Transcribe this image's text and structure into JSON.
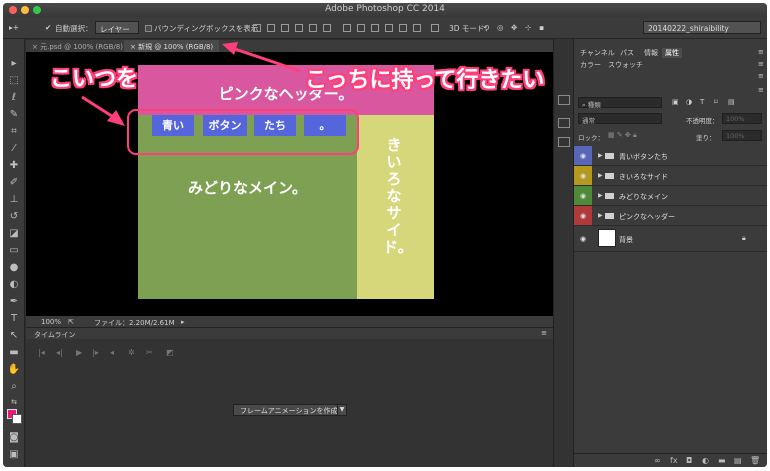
{
  "window": {
    "title": "Adobe Photoshop CC 2014"
  },
  "options_bar": {
    "auto_select_label": "自動選択：",
    "auto_select_value": "レイヤー",
    "bounding_box_label": "バウンディングボックスを表示",
    "mode_3d_label": "3D モード：",
    "workspace": "20140222_shiraibility"
  },
  "tabs": [
    {
      "label": "元.psd @ 100% (RGB/8)"
    },
    {
      "label": "新規 @ 100% (RGB/8)"
    }
  ],
  "document": {
    "header_text": "ピンクなヘッダー。",
    "main_text": "みどりなメイン。",
    "side_text": "きいろなサイド。",
    "buttons": [
      "青い",
      "ボタン",
      "たち",
      "。"
    ],
    "colors": {
      "header": "#d9579e",
      "main": "#7da053",
      "side": "#d6d67a",
      "buttons": "#5566dd",
      "annotation": "#ff3f7a"
    }
  },
  "annotations": {
    "left": "こいつを",
    "right": "こっちに持って行きたい"
  },
  "status": {
    "zoom": "100%",
    "file_info": "ファイル：2.20M/2.61M"
  },
  "timeline": {
    "title": "タイムライン",
    "create_button": "フレームアニメーションを作成"
  },
  "panel": {
    "tabs_top": [
      "チャンネル",
      "パス",
      "情報",
      "属性"
    ],
    "tabs_second": [
      "カラー",
      "スウォッチ"
    ],
    "kind_filter": "種類",
    "blend_mode": "通常",
    "opacity_label": "不透明度：",
    "opacity_value": "100%",
    "lock_label": "ロック：",
    "fill_label": "塗り：",
    "fill_value": "100%",
    "layers": [
      {
        "name": "青いボタンたち",
        "color": "#5866b8",
        "type": "group"
      },
      {
        "name": "きいろなサイド",
        "color": "#b39a1f",
        "type": "group"
      },
      {
        "name": "みどりなメイン",
        "color": "#4f8a3a",
        "type": "group"
      },
      {
        "name": "ピンクなヘッダー",
        "color": "#b03a3a",
        "type": "group"
      },
      {
        "name": "背景",
        "color": "",
        "type": "background"
      }
    ]
  }
}
